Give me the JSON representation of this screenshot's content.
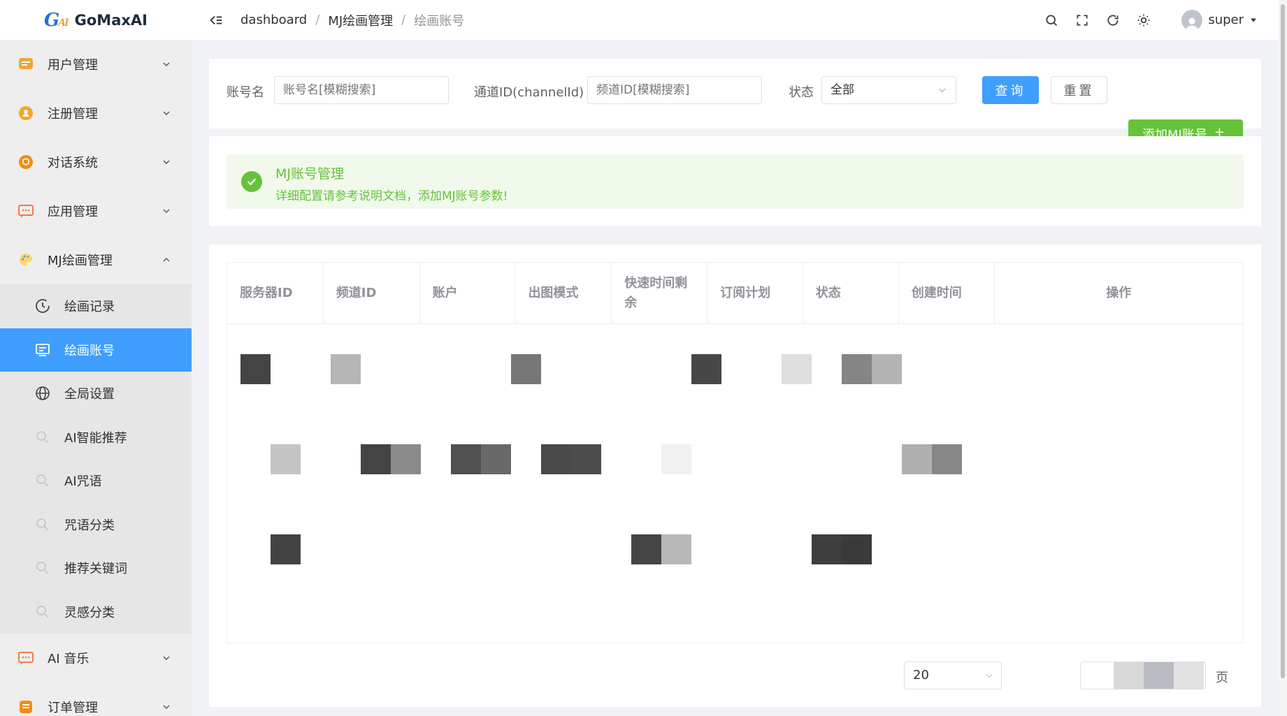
{
  "app": {
    "logo_mark": "G",
    "logo_mark_sub": "AI",
    "name": "GoMaxAI"
  },
  "sidebar": {
    "menus": [
      {
        "label": "用户管理",
        "icon": "user-manage-icon",
        "color": "#f0a43a"
      },
      {
        "label": "注册管理",
        "icon": "register-icon",
        "color": "#f5a623"
      },
      {
        "label": "对话系统",
        "icon": "chat-system-icon",
        "color": "#f28c18"
      },
      {
        "label": "应用管理",
        "icon": "app-manage-icon",
        "color": "#f07c4a"
      },
      {
        "label": "MJ绘画管理",
        "icon": "palette-icon",
        "color": "#f5c242"
      }
    ],
    "mj_submenu": [
      {
        "label": "绘画记录",
        "icon": "history-icon"
      },
      {
        "label": "绘画账号",
        "icon": "account-monitor-icon"
      },
      {
        "label": "全局设置",
        "icon": "globe-icon"
      },
      {
        "label": "AI智能推荐",
        "icon": "search-faded-icon"
      },
      {
        "label": "AI咒语",
        "icon": "search-faded-icon"
      },
      {
        "label": "咒语分类",
        "icon": "search-faded-icon"
      },
      {
        "label": "推荐关键词",
        "icon": "search-faded-icon"
      },
      {
        "label": "灵感分类",
        "icon": "search-faded-icon"
      }
    ],
    "menus_after": [
      {
        "label": "AI 音乐",
        "icon": "music-icon",
        "color": "#f07c4a"
      },
      {
        "label": "订单管理",
        "icon": "order-icon",
        "color": "#f28c18"
      }
    ]
  },
  "header": {
    "breadcrumb": [
      "dashboard",
      "MJ绘画管理",
      "绘画账号"
    ],
    "separator": "/",
    "user": "super"
  },
  "search": {
    "account_label": "账号名",
    "account_placeholder": "账号名[模糊搜索]",
    "channel_label": "通道ID(channelId)",
    "channel_placeholder": "频道ID[模糊搜索]",
    "status_label": "状态",
    "status_value": "全部",
    "query_button": "查询",
    "reset_button": "重置"
  },
  "add_button": {
    "label": "添加MJ账号",
    "icon": "+"
  },
  "alert": {
    "title": "MJ账号管理",
    "description": "详细配置请参考说明文档，添加MJ账号参数!"
  },
  "table": {
    "columns": [
      "服务器ID",
      "频道ID",
      "账户",
      "出图模式",
      "快速时间剩余",
      "订阅计划",
      "状态",
      "创建时间",
      "操作"
    ]
  },
  "pagination": {
    "page_size": "20",
    "page_suffix": "页"
  }
}
